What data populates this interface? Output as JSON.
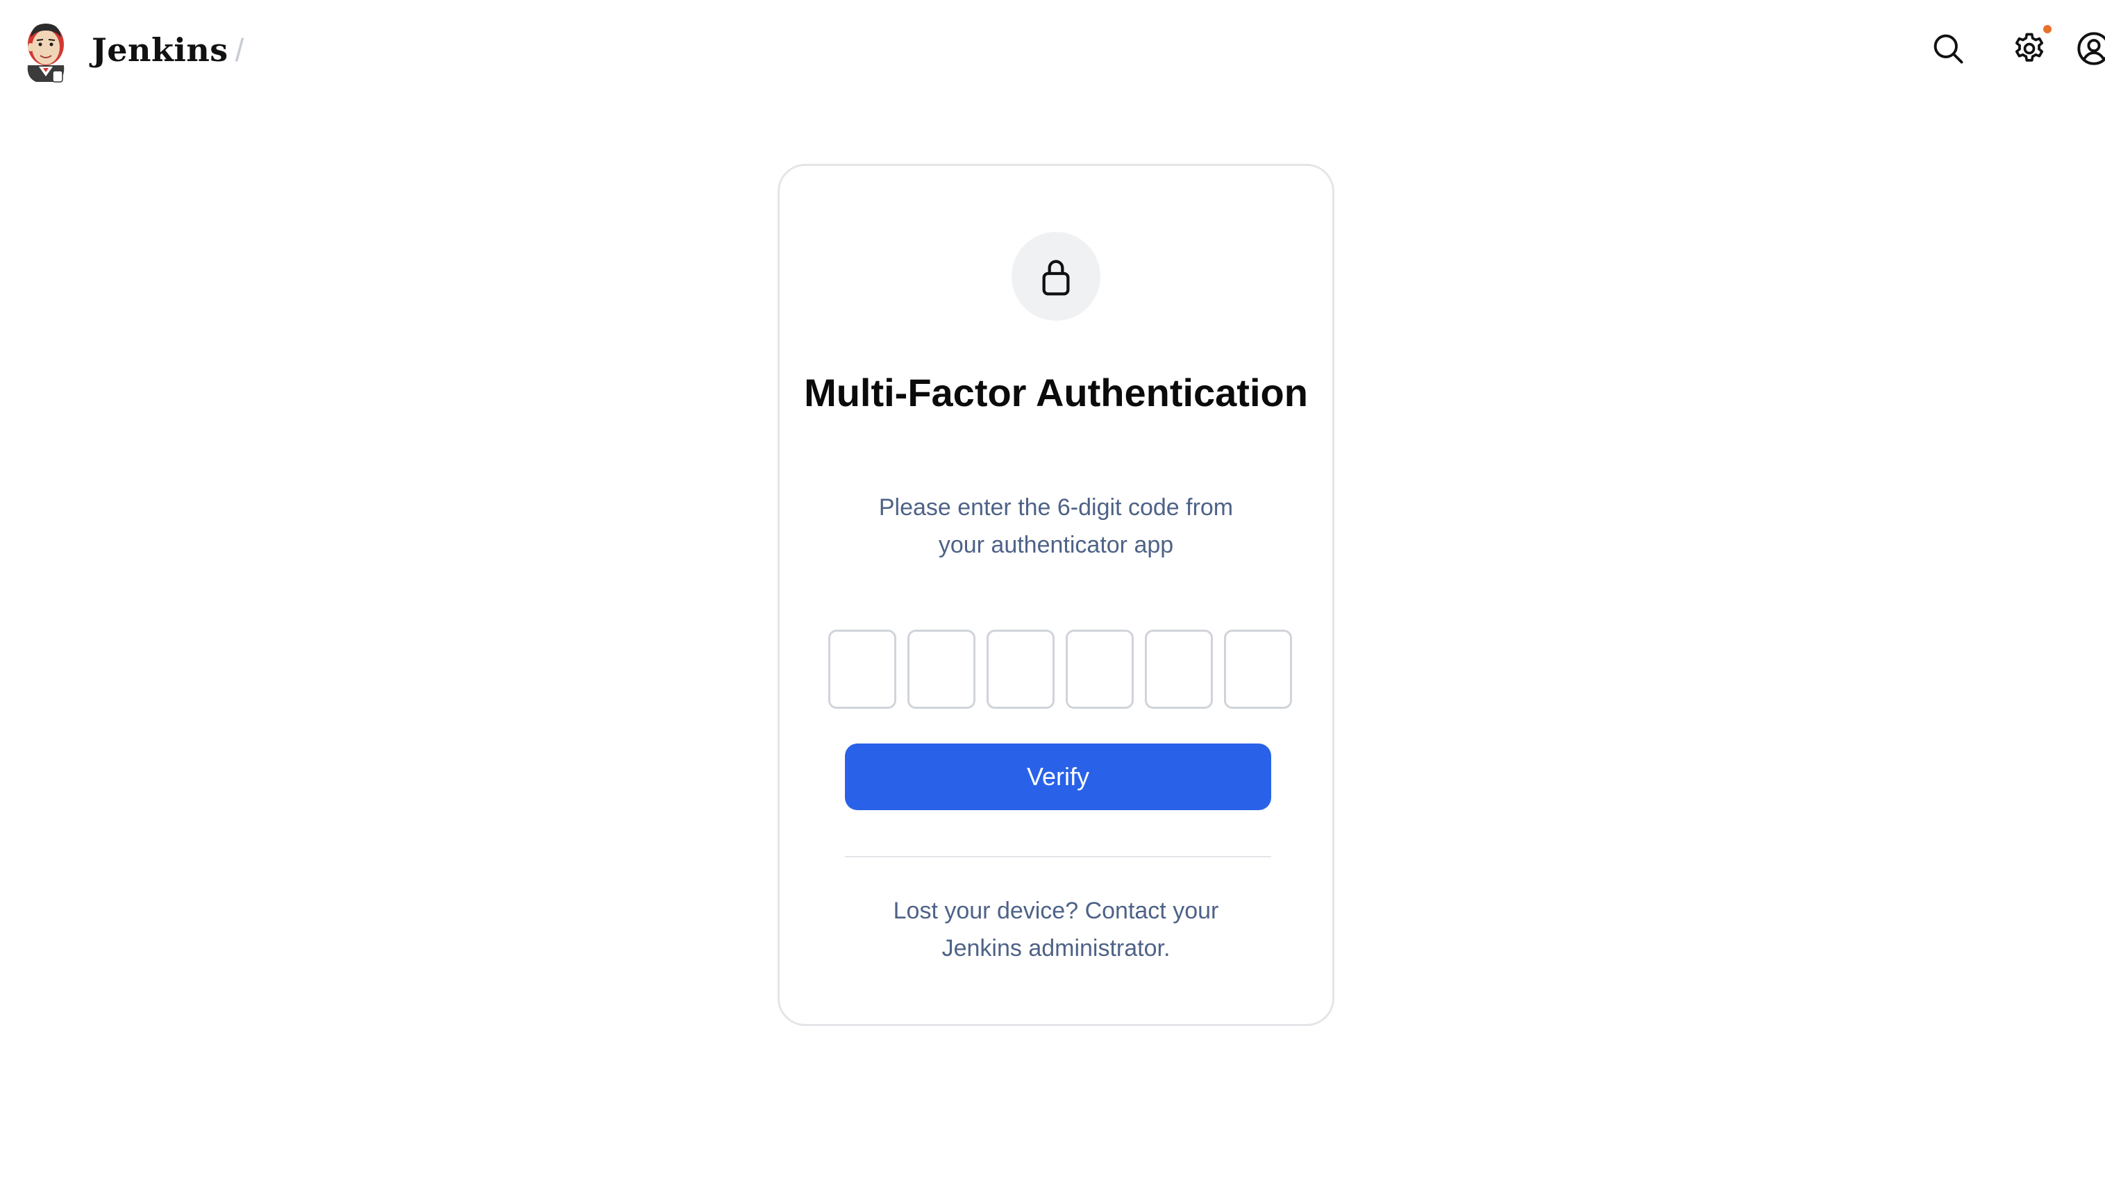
{
  "header": {
    "brand_name": "Jenkins",
    "separator": "/",
    "icons": {
      "search": "search-icon",
      "settings": "gear-icon",
      "account": "user-circle-icon"
    },
    "notification_color": "#e8702a"
  },
  "card": {
    "badge_icon": "lock-icon",
    "title": "Multi-Factor Authentication",
    "subtitle": "Please enter the 6-digit code from your authenticator app",
    "otp_digits": [
      "",
      "",
      "",
      "",
      "",
      ""
    ],
    "verify_label": "Verify",
    "help_text": "Lost your device? Contact your Jenkins administrator."
  },
  "colors": {
    "accent": "#2962e8",
    "muted_text": "#4e6287",
    "border": "#e3e5e8"
  }
}
